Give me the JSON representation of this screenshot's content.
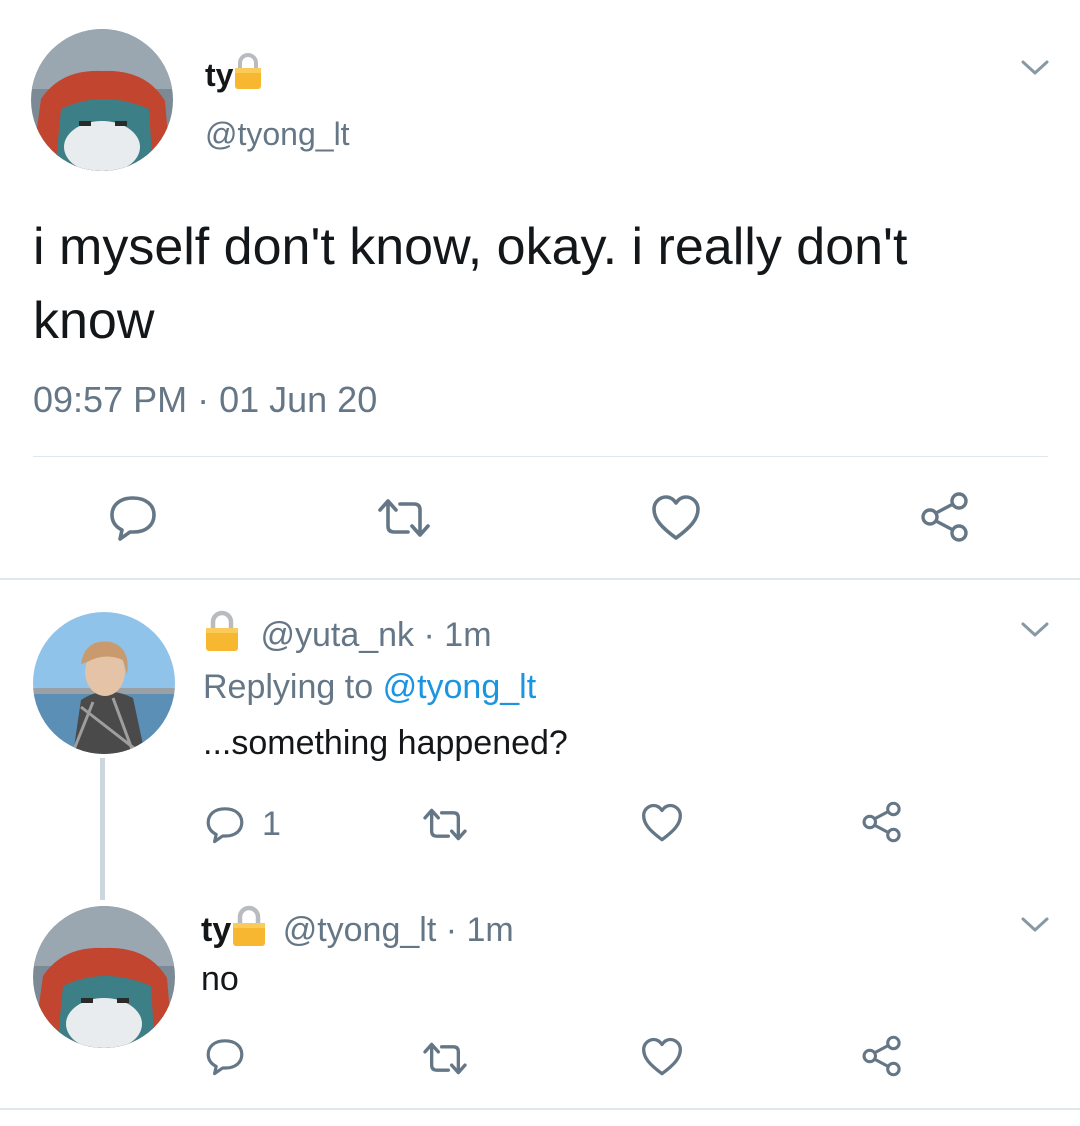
{
  "main_tweet": {
    "display_name": "ty",
    "handle": "@tyong_lt",
    "text": "i myself don't know, okay. i really don't know",
    "timestamp": "09:57 PM · 01 Jun 20"
  },
  "replies": [
    {
      "handle": "@yuta_nk",
      "age": "· 1m",
      "replying_prefix": "Replying to",
      "replying_to": "@tyong_lt",
      "text": "...something happened?",
      "reply_count": "1"
    },
    {
      "display_name": "ty",
      "handle": "@tyong_lt",
      "age": "· 1m",
      "text": "no"
    }
  ],
  "colors": {
    "text": "#14171a",
    "secondary": "#657786",
    "link": "#1b95e0",
    "divider": "#e1e8ed",
    "lock": "#f7b731"
  },
  "icons": [
    "lock-icon",
    "chevron-down-icon",
    "reply-icon",
    "retweet-icon",
    "heart-icon",
    "share-icon"
  ]
}
